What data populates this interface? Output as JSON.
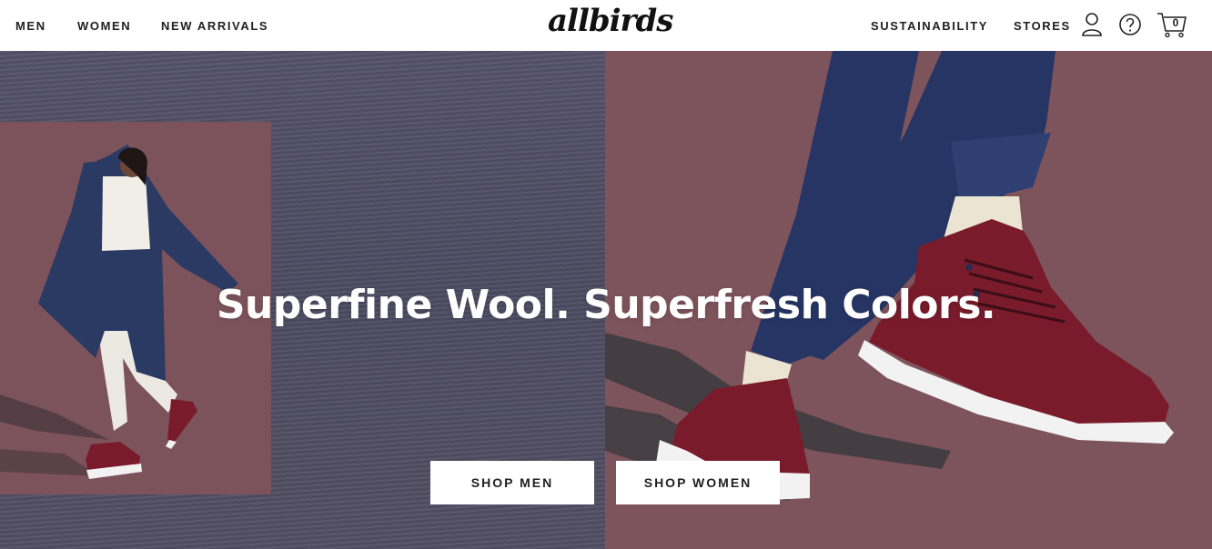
{
  "header": {
    "nav_left": [
      "MEN",
      "WOMEN",
      "NEW ARRIVALS"
    ],
    "brand": "allbirds",
    "nav_right": [
      "SUSTAINABILITY",
      "STORES"
    ],
    "icons": [
      "account-icon",
      "help-icon",
      "cart-icon"
    ],
    "cart_count": "0"
  },
  "hero": {
    "headline": "Superfine Wool. Superfresh Colors.",
    "buttons": [
      "SHOP MEN",
      "SHOP WOMEN"
    ]
  },
  "colors": {
    "left_background": "#55526a",
    "right_background": "#7e545c",
    "photo_panel": "#7c535b",
    "shoe": "#7a1b2b",
    "sole": "#f4f4f4",
    "pants": "#26355f"
  }
}
